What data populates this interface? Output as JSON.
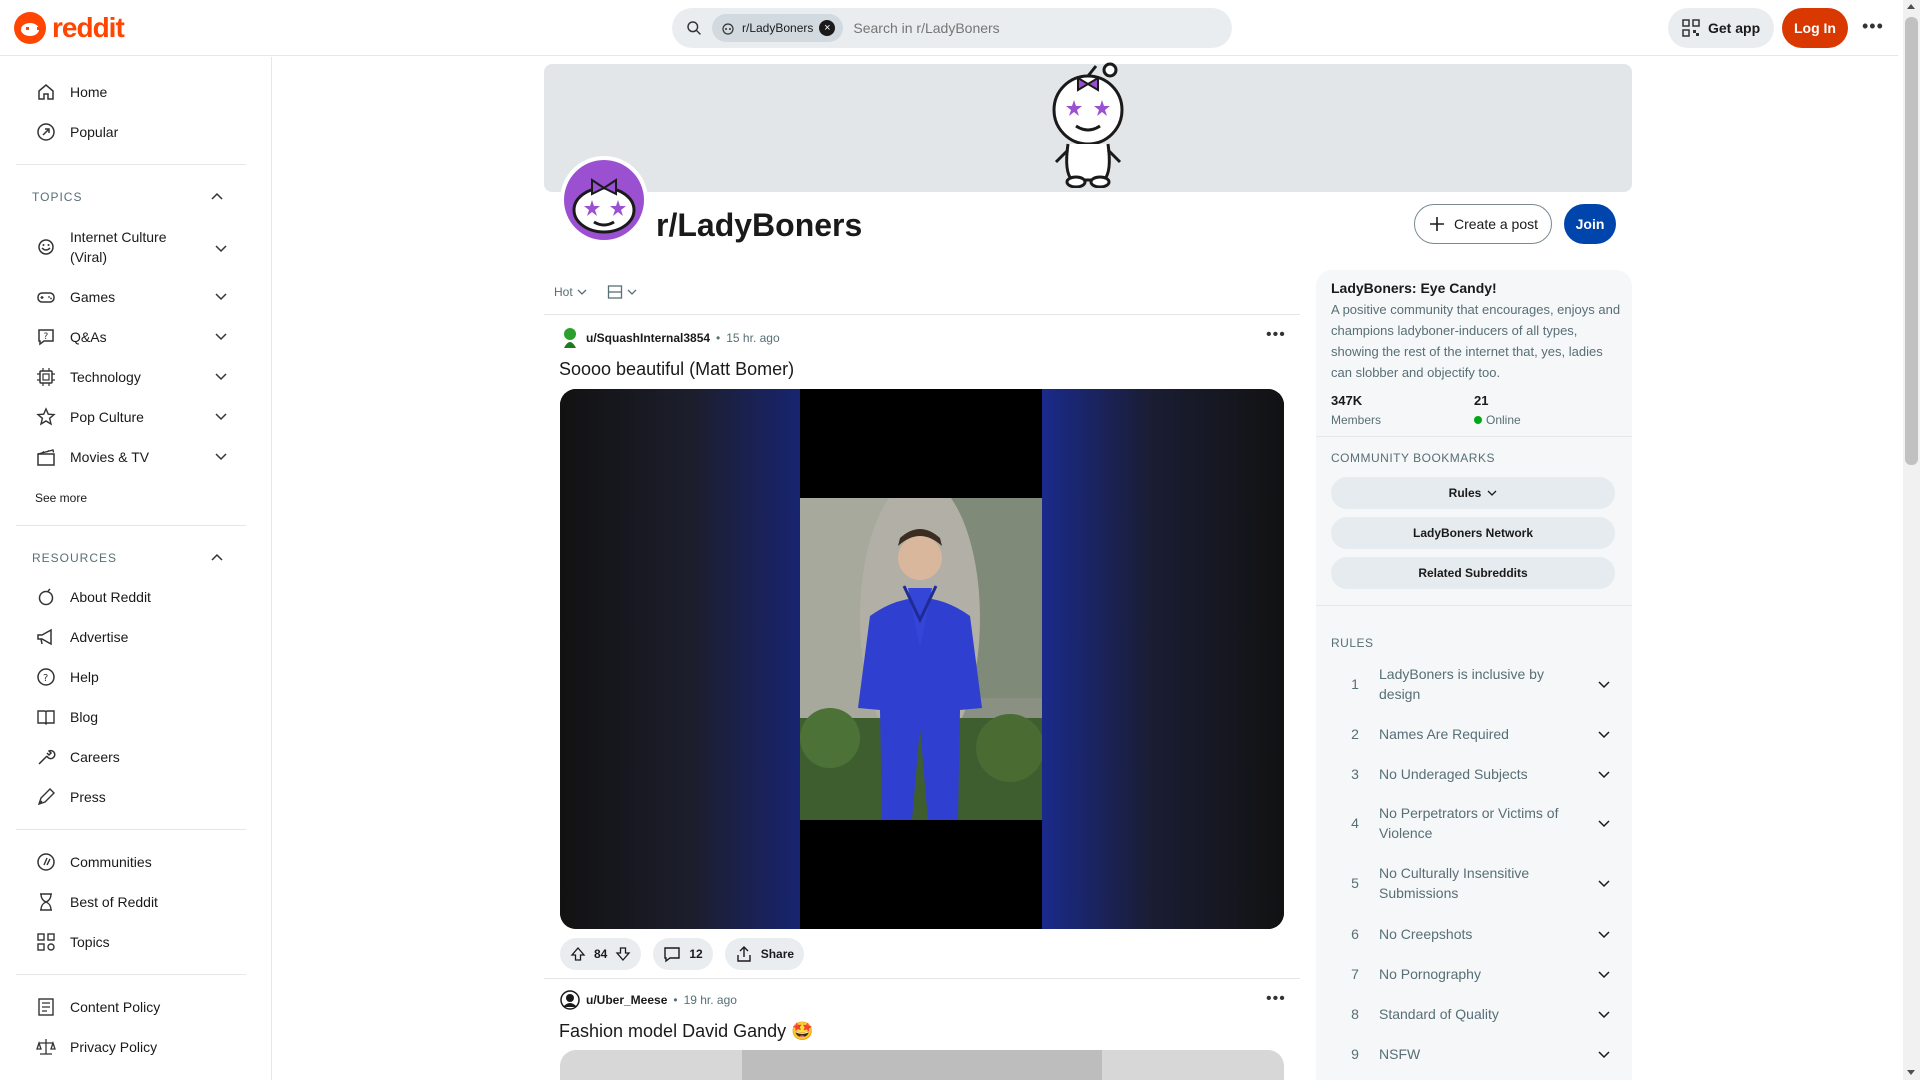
{
  "header": {
    "logo_text": "reddit",
    "search_chip": "r/LadyBoners",
    "search_placeholder": "Search in r/LadyBoners",
    "get_app": "Get app",
    "login": "Log In"
  },
  "sidebar": {
    "primary": [
      {
        "label": "Home",
        "icon": "home-icon"
      },
      {
        "label": "Popular",
        "icon": "popular-icon"
      }
    ],
    "topics_title": "TOPICS",
    "topics": [
      {
        "label": "Internet Culture (Viral)",
        "line1": "Internet Culture",
        "line2": "(Viral)",
        "icon": "internet-culture-icon"
      },
      {
        "label": "Games",
        "icon": "games-icon"
      },
      {
        "label": "Q&As",
        "icon": "qa-icon"
      },
      {
        "label": "Technology",
        "icon": "technology-icon"
      },
      {
        "label": "Pop Culture",
        "icon": "pop-culture-icon"
      },
      {
        "label": "Movies & TV",
        "icon": "movies-icon"
      }
    ],
    "see_more": "See more",
    "resources_title": "RESOURCES",
    "resources": [
      {
        "label": "About Reddit",
        "icon": "about-icon"
      },
      {
        "label": "Advertise",
        "icon": "advertise-icon"
      },
      {
        "label": "Help",
        "icon": "help-icon"
      },
      {
        "label": "Blog",
        "icon": "blog-icon"
      },
      {
        "label": "Careers",
        "icon": "careers-icon"
      },
      {
        "label": "Press",
        "icon": "press-icon"
      }
    ],
    "more": [
      {
        "label": "Communities",
        "icon": "communities-icon"
      },
      {
        "label": "Best of Reddit",
        "icon": "best-of-icon"
      },
      {
        "label": "Topics",
        "icon": "topics-icon"
      }
    ],
    "policies": [
      {
        "label": "Content Policy",
        "icon": "content-policy-icon"
      },
      {
        "label": "Privacy Policy",
        "icon": "privacy-policy-icon"
      }
    ]
  },
  "subreddit": {
    "name": "r/LadyBoners",
    "create_post": "Create a post",
    "join": "Join",
    "accent": "#9b4fd1"
  },
  "feed": {
    "sort": "Hot",
    "posts": [
      {
        "author": "u/SquashInternal3854",
        "time": "15 hr. ago",
        "title": "Soooo beautiful (Matt Bomer)",
        "votes": "84",
        "comments": "12",
        "share": "Share"
      },
      {
        "author": "u/Uber_Meese",
        "time": "19 hr. ago",
        "title": "Fashion model David Gandy 🤩"
      }
    ]
  },
  "about": {
    "title": "LadyBoners: Eye Candy!",
    "description": "A positive community that encourages, enjoys and champions ladyboner-inducers of all types, showing the rest of the internet that, yes, ladies can slobber and objectify too.",
    "members": "347K",
    "members_label": "Members",
    "online": "21",
    "online_label": "Online",
    "bookmarks_title": "COMMUNITY BOOKMARKS",
    "bookmarks": [
      "Rules",
      "LadyBoners Network",
      "Related Subreddits"
    ],
    "rules_title": "RULES",
    "rules": [
      {
        "num": "1",
        "line1": "LadyBoners is inclusive by",
        "line2": "design"
      },
      {
        "num": "2",
        "line1": "Names Are Required",
        "line2": ""
      },
      {
        "num": "3",
        "line1": "No Underaged Subjects",
        "line2": ""
      },
      {
        "num": "4",
        "line1": "No Perpetrators or Victims of",
        "line2": "Violence"
      },
      {
        "num": "5",
        "line1": "No Culturally Insensitive",
        "line2": "Submissions"
      },
      {
        "num": "6",
        "line1": "No Creepshots",
        "line2": ""
      },
      {
        "num": "7",
        "line1": "No Pornography",
        "line2": ""
      },
      {
        "num": "8",
        "line1": "Standard of Quality",
        "line2": ""
      },
      {
        "num": "9",
        "line1": "NSFW",
        "line2": ""
      }
    ]
  }
}
